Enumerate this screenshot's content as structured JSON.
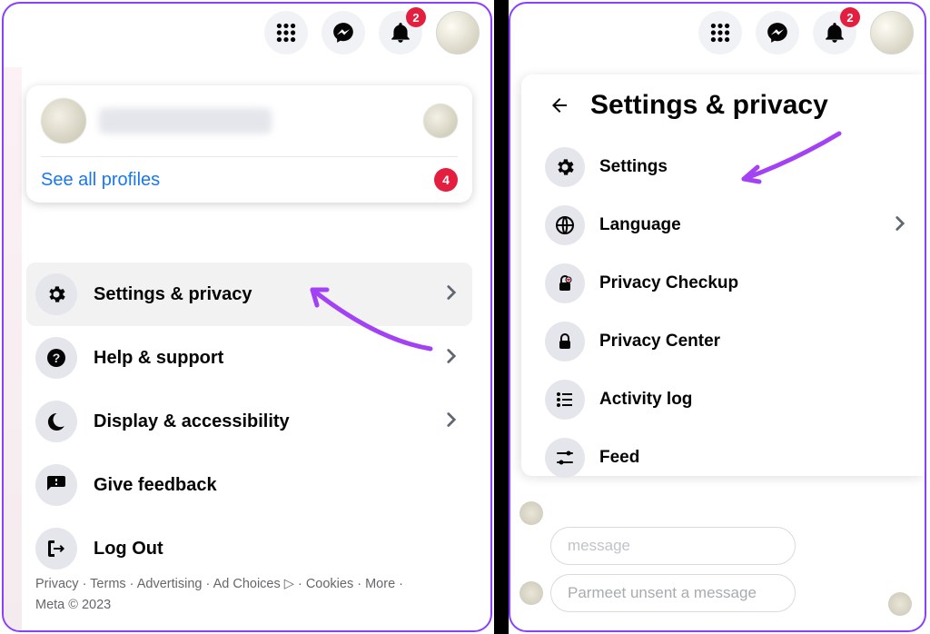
{
  "topbar": {
    "notification_badge": "2"
  },
  "left": {
    "see_all_profiles": "See all profiles",
    "profiles_badge": "4",
    "menu": {
      "settings_privacy": "Settings & privacy",
      "help_support": "Help & support",
      "display_accessibility": "Display & accessibility",
      "give_feedback": "Give feedback",
      "log_out": "Log Out"
    },
    "footer": {
      "privacy": "Privacy",
      "terms": "Terms",
      "advertising": "Advertising",
      "ad_choices": "Ad Choices",
      "cookies": "Cookies",
      "more": "More",
      "meta": "Meta © 2023"
    }
  },
  "right": {
    "title": "Settings & privacy",
    "items": {
      "settings": "Settings",
      "language": "Language",
      "privacy_checkup": "Privacy Checkup",
      "privacy_center": "Privacy Center",
      "activity_log": "Activity log",
      "feed": "Feed"
    },
    "chat": {
      "bubble1": "message",
      "bubble2": "Parmeet unsent a message"
    }
  }
}
